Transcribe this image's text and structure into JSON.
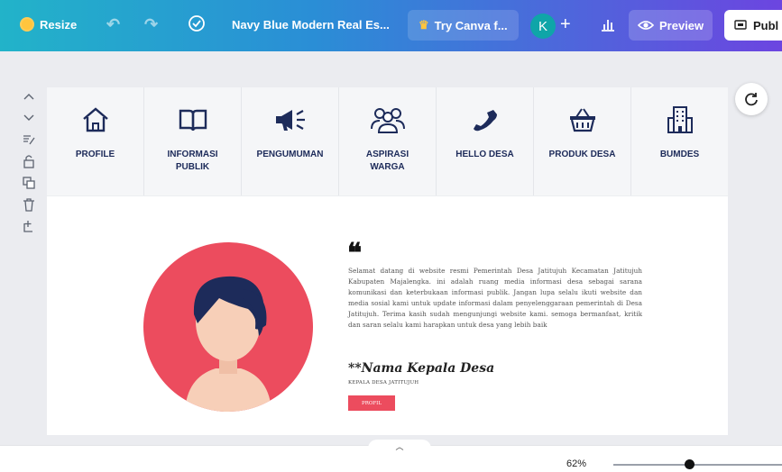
{
  "toolbar": {
    "resize_label": "Resize",
    "document_title": "Navy Blue Modern Real Es...",
    "try_canva_label": "Try Canva f...",
    "avatar_initial": "K",
    "preview_label": "Preview",
    "publish_label": "Publ"
  },
  "nav_menu": [
    {
      "label": "PROFILE",
      "icon": "home-icon"
    },
    {
      "label": "INFORMASI PUBLIK",
      "icon": "book-icon"
    },
    {
      "label": "PENGUMUMAN",
      "icon": "megaphone-icon"
    },
    {
      "label": "ASPIRASI WARGA",
      "icon": "people-group-icon"
    },
    {
      "label": "HELLO DESA",
      "icon": "phone-icon"
    },
    {
      "label": "PRODUK DESA",
      "icon": "basket-icon"
    },
    {
      "label": "BUMDES",
      "icon": "building-icon"
    }
  ],
  "welcome": {
    "quote_mark": "❝",
    "body": "Selamat datang di website resmi Pemerintah Desa Jatitujuh Kecamatan Jatitujuh Kabupaten Majalengka. ini adalah ruang media informasi desa sebagai sarana komunikasi dan keterbukaan informasi publik. Jangan lupa selalu ikuti website dan media sosial kami untuk update informasi dalam penyelenggaraan pemerintah di Desa Jatitujuh. Terima kasih sudah mengunjungi website kami. semoga bermanfaat, kritik dan saran selalu kami harapkan untuk desa yang lebih baik",
    "signature": "**Nama Kepala Desa",
    "signature_title": "KEPALA DESA JATITUJUH",
    "profile_button": "PROFIL"
  },
  "colors": {
    "accent": "#ec4c5e",
    "navy": "#1d2b5a",
    "skin": "#f7cfb8"
  },
  "zoom": {
    "label": "62%",
    "value": 0.62
  }
}
